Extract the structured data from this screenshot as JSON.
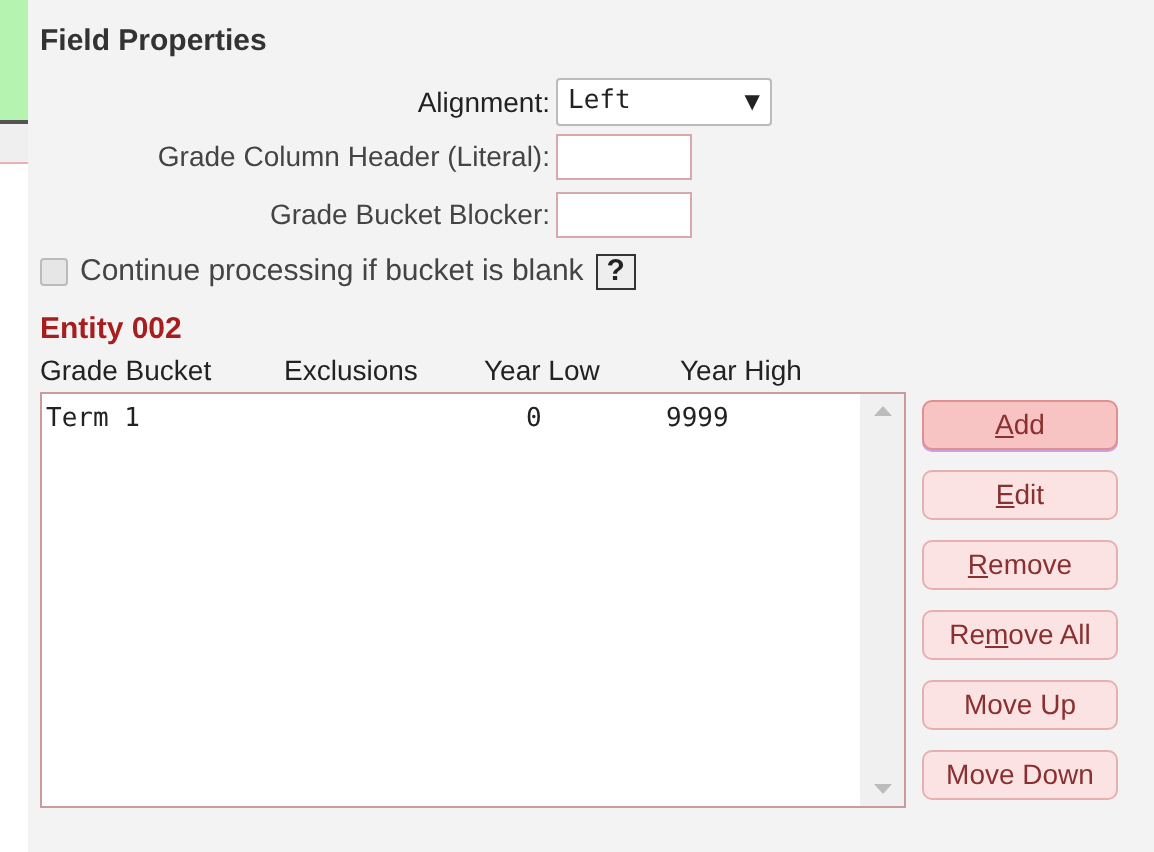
{
  "title": "Field Properties",
  "alignment": {
    "label": "Alignment:",
    "value": "Left",
    "arrow": "▼"
  },
  "fields": [
    {
      "label": "Grade Column Header (Literal):"
    },
    {
      "label": "Grade Bucket Blocker:"
    }
  ],
  "continue_option": {
    "label": "Continue processing if bucket is blank",
    "checked": false,
    "help": "?"
  },
  "entity": {
    "title": "Entity 002",
    "columns": [
      "Grade Bucket",
      "Exclusions",
      "Year Low",
      "Year High"
    ],
    "rows": [
      {
        "bucket": "Term 1",
        "year_low": "0",
        "year_high": "9999"
      }
    ]
  },
  "buttons": [
    {
      "parts": [
        {
          "text": "A",
          "underlined": true
        },
        {
          "text": "dd",
          "underlined": false
        }
      ],
      "focused": true
    },
    {
      "parts": [
        {
          "text": "E",
          "underlined": true
        },
        {
          "text": "dit",
          "underlined": false
        }
      ],
      "focused": false
    },
    {
      "parts": [
        {
          "text": "R",
          "underlined": true
        },
        {
          "text": "emove",
          "underlined": false
        }
      ],
      "focused": false
    },
    {
      "parts": [
        {
          "text": "Re",
          "underlined": false
        },
        {
          "text": "m",
          "underlined": true
        },
        {
          "text": "ove All",
          "underlined": false
        }
      ],
      "focused": false
    },
    {
      "parts": [
        {
          "text": "Move Up",
          "underlined": false
        }
      ],
      "focused": false
    },
    {
      "parts": [
        {
          "text": "Move Down",
          "underlined": false
        }
      ],
      "focused": false
    }
  ]
}
